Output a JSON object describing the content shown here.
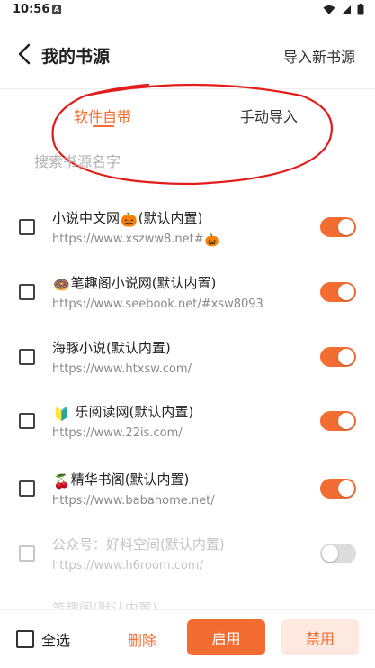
{
  "status_bar": {
    "time": "10:56",
    "notification_letter": "A",
    "icons": [
      "wifi-icon",
      "signal-icon",
      "battery-icon"
    ]
  },
  "header": {
    "title": "我的书源",
    "action": "导入新书源"
  },
  "tabs": [
    {
      "label": "软件自带",
      "active": true
    },
    {
      "label": "手动导入",
      "active": false
    }
  ],
  "search": {
    "placeholder": "搜索书源名字",
    "value": ""
  },
  "sources": [
    {
      "prefix": "",
      "name": "小说中文网",
      "suffix_emoji": "🎃",
      "tag": "(默认内置)",
      "url": "https://www.xszww8.net#",
      "url_emoji": "🎃",
      "checked": false,
      "enabled": true
    },
    {
      "prefix": "🍩",
      "name": "笔趣阁小说网",
      "suffix_emoji": "",
      "tag": "(默认内置)",
      "url": "https://www.seebook.net/#xsw8093",
      "url_emoji": "",
      "checked": false,
      "enabled": true
    },
    {
      "prefix": "",
      "name": "海豚小说",
      "suffix_emoji": "",
      "tag": "(默认内置)",
      "url": "https://www.htxsw.com/",
      "url_emoji": "",
      "checked": false,
      "enabled": true
    },
    {
      "prefix": "🔰",
      "name": " 乐阅读网",
      "suffix_emoji": "",
      "tag": "(默认内置)",
      "url": "https://www.22is.com/",
      "url_emoji": "",
      "checked": false,
      "enabled": true
    },
    {
      "prefix": "🍒",
      "name": "精华书阁",
      "suffix_emoji": "",
      "tag": "(默认内置)",
      "url": "https://www.babahome.net/",
      "url_emoji": "",
      "checked": false,
      "enabled": true
    },
    {
      "prefix": "",
      "name": "公众号：好料空间",
      "suffix_emoji": "",
      "tag": "(默认内置)",
      "url": "https://www.h6room.com/",
      "url_emoji": "",
      "checked": false,
      "enabled": false
    }
  ],
  "partial_row_text": "笔趣阁(默认内置)",
  "bottom_bar": {
    "select_all": "全选",
    "delete": "删除",
    "enable": "启用",
    "disable": "禁用"
  },
  "colors": {
    "accent": "#f36d33",
    "annotation": "#e31b1b",
    "toggle_off": "#dcdcdc",
    "disable_bg": "#fde9df"
  }
}
